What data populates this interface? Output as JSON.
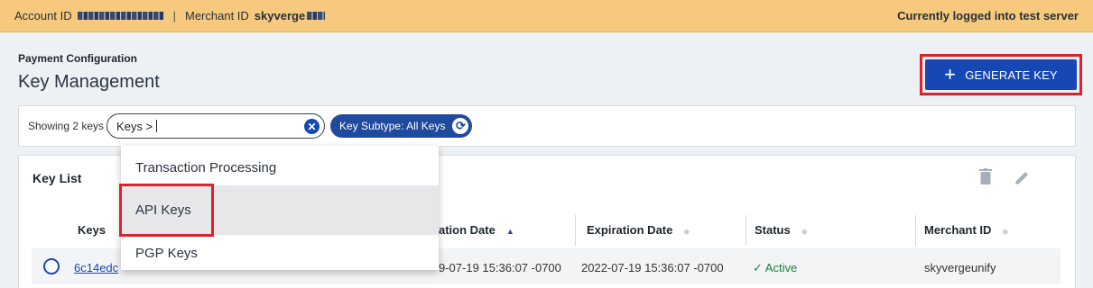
{
  "topbar": {
    "account_label": "Account ID",
    "divider": "|",
    "merchant_label": "Merchant ID",
    "merchant_value": "skyverge",
    "server_status": "Currently logged into test server"
  },
  "header": {
    "breadcrumb": "Payment Configuration",
    "title": "Key Management",
    "generate_button_label": "GENERATE KEY",
    "generate_button_icon": "plus-icon",
    "accent_color": "#1747b3",
    "highlight_color": "#e0202a"
  },
  "filter": {
    "showing_text": "Showing 2 keys",
    "search_value": "Keys >",
    "chip_label": "Key Subtype: All Keys"
  },
  "dropdown": {
    "items": [
      {
        "label": "Transaction Processing"
      },
      {
        "label": "API Keys"
      },
      {
        "label": "PGP Keys"
      }
    ]
  },
  "key_list": {
    "title": "Key List",
    "columns": [
      {
        "label": "Keys"
      },
      {
        "label": "ation Date"
      },
      {
        "label": "Expiration Date"
      },
      {
        "label": "Status"
      },
      {
        "label": "Merchant ID"
      }
    ],
    "rows": [
      {
        "key": "6c14edc",
        "creation_date": "9-07-19 15:36:07 -0700",
        "expiration_date": "2022-07-19 15:36:07 -0700",
        "status": "Active",
        "merchant_id": "skyvergeunify"
      }
    ]
  }
}
